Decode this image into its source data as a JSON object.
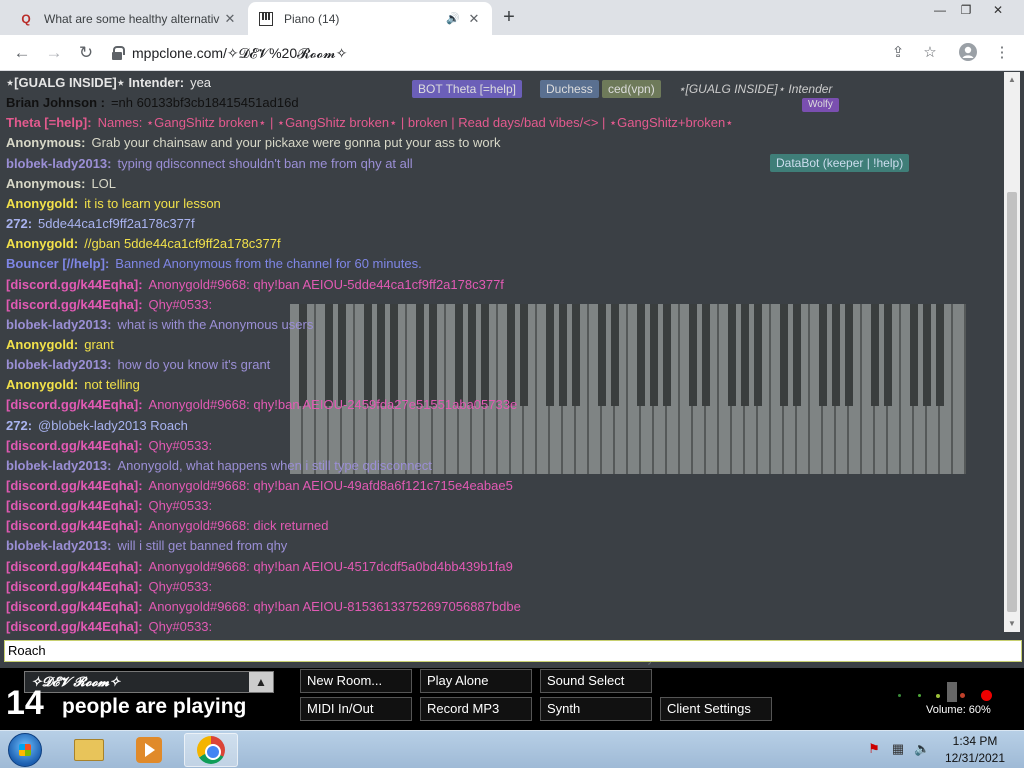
{
  "browser": {
    "tabs": [
      {
        "title": "What are some healthy alternativ",
        "favicon": "Q",
        "close": "✕"
      },
      {
        "title": "Piano (14)",
        "favicon": "piano-icon",
        "close": "✕"
      }
    ],
    "new_tab": "+",
    "address": "mppclone.com/✧𝓓𝓔𝓥%20𝓡𝓸𝓸𝓶✧"
  },
  "chat": {
    "messages": [
      {
        "nick": "⋆[GUALG INSIDE]⋆ Intender:",
        "text": "yea",
        "nick_color": "#e6e6e6",
        "text_color": "#e6e6e6"
      },
      {
        "nick": "Brian Johnson :",
        "text": "=nh 60133bf3cb18415451ad16d",
        "nick_color": "#111111",
        "text_color": "#111111"
      },
      {
        "nick": "Theta [=help]:",
        "text": "Names: ⋆GangShitz broken⋆ | ⋆GangShitz broken⋆ | broken | Read days/bad vibes/<> | ⋆GangShitz+broken⋆",
        "nick_color": "#e35a8e",
        "text_color": "#e35a8e"
      },
      {
        "nick": "Anonymous:",
        "text": "Grab your chainsaw and your pickaxe were gonna put your ass to work",
        "nick_color": "#d8d8c8",
        "text_color": "#d8d8c8"
      },
      {
        "nick": "blobek-lady2013:",
        "text": "typing qdisconnect shouldn't ban me from qhy at all",
        "nick_color": "#9b8fd6",
        "text_color": "#9b8fd6"
      },
      {
        "nick": "Anonymous:",
        "text": "LOL",
        "nick_color": "#d8d8c8",
        "text_color": "#d8d8c8"
      },
      {
        "nick": "Anonygold:",
        "text": "it is to learn your lesson",
        "nick_color": "#f2e14a",
        "text_color": "#f2e14a"
      },
      {
        "nick": "272:",
        "text": "5dde44ca1cf9ff2a178c377f",
        "nick_color": "#a9b3f0",
        "text_color": "#a9b3f0"
      },
      {
        "nick": "Anonygold:",
        "text": "//gban 5dde44ca1cf9ff2a178c377f",
        "nick_color": "#f2e14a",
        "text_color": "#f2e14a"
      },
      {
        "nick": "Bouncer [//help]:",
        "text": "Banned Anonymous from the channel for 60 minutes.",
        "nick_color": "#7f86e6",
        "text_color": "#7f86e6"
      },
      {
        "nick": "[discord.gg/k44Eqha]:",
        "text": "Anonygold#9668: qhy!ban AEIOU-5dde44ca1cf9ff2a178c377f",
        "nick_color": "#e25ab4",
        "text_color": "#e25ab4"
      },
      {
        "nick": "[discord.gg/k44Eqha]:",
        "text": "Qhy#0533:",
        "nick_color": "#e25ab4",
        "text_color": "#e25ab4"
      },
      {
        "nick": "blobek-lady2013:",
        "text": "what is with the Anonymous users",
        "nick_color": "#9b8fd6",
        "text_color": "#9b8fd6"
      },
      {
        "nick": "Anonygold:",
        "text": "grant",
        "nick_color": "#f2e14a",
        "text_color": "#f2e14a"
      },
      {
        "nick": "blobek-lady2013:",
        "text": "how do you know it's grant",
        "nick_color": "#9b8fd6",
        "text_color": "#9b8fd6"
      },
      {
        "nick": "Anonygold:",
        "text": "not telling",
        "nick_color": "#f2e14a",
        "text_color": "#f2e14a"
      },
      {
        "nick": "[discord.gg/k44Eqha]:",
        "text": "Anonygold#9668: qhy!ban AEIOU-2459fda27e51551aba05733e",
        "nick_color": "#e25ab4",
        "text_color": "#e25ab4"
      },
      {
        "nick": "272:",
        "text": "@blobek-lady2013 Roach",
        "nick_color": "#a9b3f0",
        "text_color": "#a9b3f0"
      },
      {
        "nick": "[discord.gg/k44Eqha]:",
        "text": "Qhy#0533:",
        "nick_color": "#e25ab4",
        "text_color": "#e25ab4"
      },
      {
        "nick": "blobek-lady2013:",
        "text": "Anonygold, what happens when i still type qdisconnect",
        "nick_color": "#9b8fd6",
        "text_color": "#9b8fd6"
      },
      {
        "nick": "[discord.gg/k44Eqha]:",
        "text": "Anonygold#9668: qhy!ban AEIOU-49afd8a6f121c715e4eabae5",
        "nick_color": "#e25ab4",
        "text_color": "#e25ab4"
      },
      {
        "nick": "[discord.gg/k44Eqha]:",
        "text": "Qhy#0533:",
        "nick_color": "#e25ab4",
        "text_color": "#e25ab4"
      },
      {
        "nick": "[discord.gg/k44Eqha]:",
        "text": "Anonygold#9668: dick returned",
        "nick_color": "#e25ab4",
        "text_color": "#e25ab4"
      },
      {
        "nick": "blobek-lady2013:",
        "text": "will i still get banned from qhy",
        "nick_color": "#9b8fd6",
        "text_color": "#9b8fd6"
      },
      {
        "nick": "[discord.gg/k44Eqha]:",
        "text": "Anonygold#9668: qhy!ban AEIOU-4517dcdf5a0bd4bb439b1fa9",
        "nick_color": "#e25ab4",
        "text_color": "#e25ab4"
      },
      {
        "nick": "[discord.gg/k44Eqha]:",
        "text": "Qhy#0533:",
        "nick_color": "#e25ab4",
        "text_color": "#e25ab4"
      },
      {
        "nick": "[discord.gg/k44Eqha]:",
        "text": "Anonygold#9668: qhy!ban AEIOU-81536133752697056887bdbe",
        "nick_color": "#e25ab4",
        "text_color": "#e25ab4"
      },
      {
        "nick": "[discord.gg/k44Eqha]:",
        "text": "Qhy#0533:",
        "nick_color": "#e25ab4",
        "text_color": "#e25ab4"
      }
    ],
    "input_value": "Roach"
  },
  "user_tags": {
    "theta": "BOT  Theta [=help]",
    "duchess": "Duchess",
    "ced": "ced(vpn)",
    "gualg": "⋆[GUALG INSIDE]⋆ Intender",
    "databot": "DataBot (keeper | !help)",
    "wolfy": "Wolfy",
    "blobek": "blobek-lady2013"
  },
  "room": {
    "name": "✧𝓓𝓔𝓥 𝓡𝓸𝓸𝓶✧",
    "count": "14",
    "count_label": "people are playing"
  },
  "buttons": {
    "new_room": "New Room...",
    "play_alone": "Play Alone",
    "sound_select": "Sound Select",
    "midi": "MIDI In/Out",
    "record": "Record MP3",
    "synth": "Synth",
    "client_settings": "Client Settings"
  },
  "volume": "Volume: 60%",
  "taskbar": {
    "time": "1:34 PM",
    "date": "12/31/2021"
  }
}
